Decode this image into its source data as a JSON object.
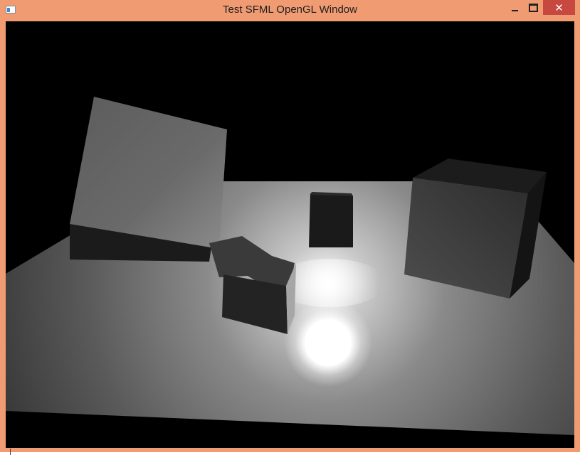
{
  "window": {
    "title": "Test SFML OpenGL Window",
    "frame_color": "#f19b72",
    "close_color": "#c7483e",
    "icons": {
      "app": "app-window-icon",
      "minimize": "minimize-icon",
      "maximize": "maximize-icon",
      "close": "close-icon"
    },
    "close_glyph": "✕"
  },
  "scene": {
    "background": "#000000",
    "objects": [
      "floor-plane",
      "large-tilted-cube",
      "small-dark-cube",
      "right-cube",
      "arrow-block",
      "point-light-sphere"
    ]
  }
}
